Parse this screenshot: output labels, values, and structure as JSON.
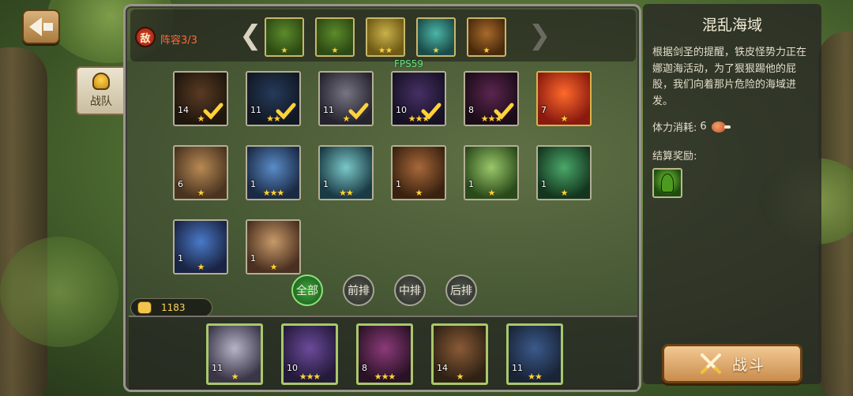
{
  "enemy": {
    "badge": "敌",
    "lineup_label": "阵容3/3",
    "prev": "❮",
    "next": "❯",
    "slots": [
      {
        "name": "green-goblin-1",
        "stars": "★",
        "colors": [
          "#5c8b2a",
          "#2d4a14"
        ]
      },
      {
        "name": "green-goblin-2",
        "stars": "★",
        "colors": [
          "#5c8b2a",
          "#2d4a14"
        ]
      },
      {
        "name": "yellow-beast",
        "stars": "★★",
        "colors": [
          "#c9b14a",
          "#6e5a14"
        ]
      },
      {
        "name": "teal-spirit",
        "stars": "★",
        "colors": [
          "#4cb5a8",
          "#1a4d49"
        ]
      },
      {
        "name": "goblin-cannon",
        "stars": "★",
        "colors": [
          "#a86a2c",
          "#4a2a0c"
        ]
      }
    ]
  },
  "fps": "FPS59",
  "side_tab": {
    "label": "战队"
  },
  "roster": [
    {
      "level": "14",
      "stars": "★",
      "selected": true,
      "colors": [
        "#8a5a36",
        "#2f2214"
      ]
    },
    {
      "level": "11",
      "stars": "★★",
      "selected": true,
      "colors": [
        "#3a5a8c",
        "#1a2436"
      ]
    },
    {
      "level": "11",
      "stars": "★",
      "selected": true,
      "colors": [
        "#b8b4c8",
        "#3a3648"
      ]
    },
    {
      "level": "10",
      "stars": "★★★",
      "selected": true,
      "colors": [
        "#6c4a9c",
        "#241a3a"
      ]
    },
    {
      "level": "8",
      "stars": "★★★",
      "selected": true,
      "colors": [
        "#8c3a7a",
        "#2a1226"
      ]
    },
    {
      "level": "7",
      "stars": "★",
      "selected": false,
      "gold": true,
      "colors": [
        "#ff6a2a",
        "#8a1a10"
      ]
    },
    {
      "level": "6",
      "stars": "★",
      "selected": false,
      "colors": [
        "#b88a54",
        "#4a3420"
      ]
    },
    {
      "level": "1",
      "stars": "★★★",
      "selected": false,
      "colors": [
        "#5a8cc8",
        "#1a2a44"
      ]
    },
    {
      "level": "1",
      "stars": "★★",
      "selected": false,
      "colors": [
        "#7ac8c8",
        "#1a3a44"
      ]
    },
    {
      "level": "1",
      "stars": "★",
      "selected": false,
      "colors": [
        "#a8683a",
        "#3a2210"
      ]
    },
    {
      "level": "1",
      "stars": "★",
      "selected": false,
      "colors": [
        "#9ac86a",
        "#2a4a1a"
      ]
    },
    {
      "level": "1",
      "stars": "★",
      "selected": false,
      "colors": [
        "#4aa86a",
        "#14361e"
      ]
    },
    {
      "level": "1",
      "stars": "★",
      "selected": false,
      "colors": [
        "#4a7ac8",
        "#1a2444"
      ]
    },
    {
      "level": "1",
      "stars": "★",
      "selected": false,
      "colors": [
        "#c89a6a",
        "#4a3020"
      ]
    }
  ],
  "filters": [
    {
      "label": "全部",
      "active": true
    },
    {
      "label": "前排",
      "active": false
    },
    {
      "label": "中排",
      "active": false
    },
    {
      "label": "后排",
      "active": false
    }
  ],
  "power": "1183",
  "team": [
    {
      "level": "11",
      "stars": "★",
      "colors": [
        "#b8b4c8",
        "#3a3648"
      ]
    },
    {
      "level": "10",
      "stars": "★★★",
      "colors": [
        "#6c4a9c",
        "#241a3a"
      ]
    },
    {
      "level": "8",
      "stars": "★★★",
      "colors": [
        "#8c3a7a",
        "#2a1226"
      ]
    },
    {
      "level": "14",
      "stars": "★",
      "colors": [
        "#8a5a36",
        "#2f2214"
      ]
    },
    {
      "level": "11",
      "stars": "★★",
      "colors": [
        "#3a5a8c",
        "#1a2436"
      ]
    }
  ],
  "info": {
    "title": "混乱海域",
    "description": "根据剑圣的提醒，铁皮怪势力正在娜迦海活动，为了狠狠踢他的屁股，我们向着那片危险的海域进发。",
    "stamina_label": "体力消耗:",
    "stamina_value": "6",
    "reward_label": "结算奖励:"
  },
  "fight_button": {
    "label": "战斗"
  },
  "colors": {
    "accent": "#d9b44a",
    "panel_border": "#9a958a",
    "active_filter": "#3ea63a"
  }
}
